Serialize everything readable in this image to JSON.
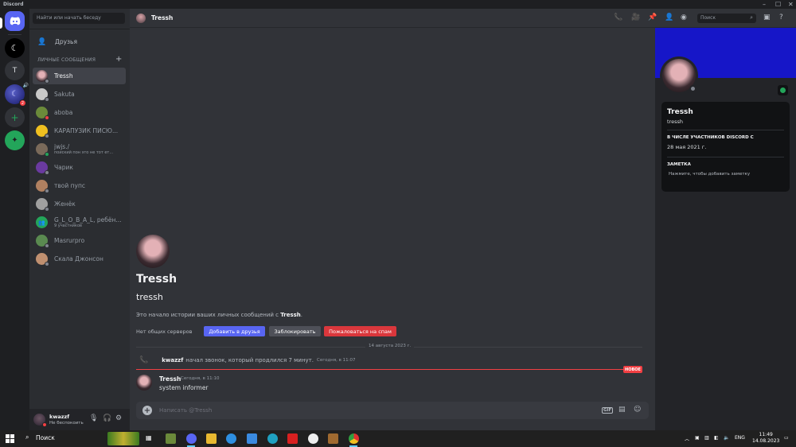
{
  "window": {
    "title": "Discord"
  },
  "guilds": {
    "home_letter": "",
    "t_letter": "T",
    "badge": "2"
  },
  "sidebar": {
    "search_placeholder": "Найти или начать беседу",
    "friends_label": "Друзья",
    "dm_header": "ЛИЧНЫЕ СООБЩЕНИЯ",
    "dms": [
      {
        "name": "Tressh",
        "sub": ""
      },
      {
        "name": "Sakuta",
        "sub": ""
      },
      {
        "name": "aboba",
        "sub": ""
      },
      {
        "name": "КАРАПУЗИК ПИСЮ...",
        "sub": ""
      },
      {
        "name": "jwjs./",
        "sub": "поиский пон это не тот ет..."
      },
      {
        "name": "Чарик",
        "sub": ""
      },
      {
        "name": "твой пупс",
        "sub": ""
      },
      {
        "name": "Женёк",
        "sub": ""
      },
      {
        "name": "G_L_O_B_A_L, ребён...",
        "sub": "9 участников"
      },
      {
        "name": "Masrurpro",
        "sub": ""
      },
      {
        "name": "Скала Джонсон",
        "sub": ""
      }
    ]
  },
  "user": {
    "name": "kwazzf",
    "status": "Не беспокоить"
  },
  "header": {
    "name": "Tressh",
    "search_placeholder": "Поиск"
  },
  "main": {
    "profile_name": "Tressh",
    "profile_tag": "tressh",
    "intro_prefix": "Это начало истории ваших личных сообщений с ",
    "intro_name": "Tressh",
    "intro_suffix": ".",
    "no_servers": "Нет общих серверов",
    "btn_add": "Добавить в друзья",
    "btn_block": "Заблокировать",
    "btn_spam": "Пожаловаться на спам",
    "date_divider": "14 августа 2023 г.",
    "call_user": "kwazzf",
    "call_text": "начал звонок, который продлился 7 минут.",
    "call_time": "Сегодня, в 11:07",
    "new_badge": "НОВОЕ",
    "msg_author": "Tressh",
    "msg_time": "Сегодня, в 11:10",
    "msg_text": "system informer",
    "composer_placeholder": "Написать @Tressh",
    "gif_label": "GIF"
  },
  "profile": {
    "name": "Tressh",
    "tag": "tressh",
    "member_since_label": "В ЧИСЛЕ УЧАСТНИКОВ DISCORD С",
    "member_since": "28 мая 2021 г.",
    "note_label": "ЗАМЕТКА",
    "note_placeholder": "Нажмите, чтобы добавить заметку",
    "banner_color": "#1616c8"
  },
  "taskbar": {
    "search": "Поиск",
    "lang": "ENG",
    "time": "11:49",
    "date": "14.08.2023"
  }
}
